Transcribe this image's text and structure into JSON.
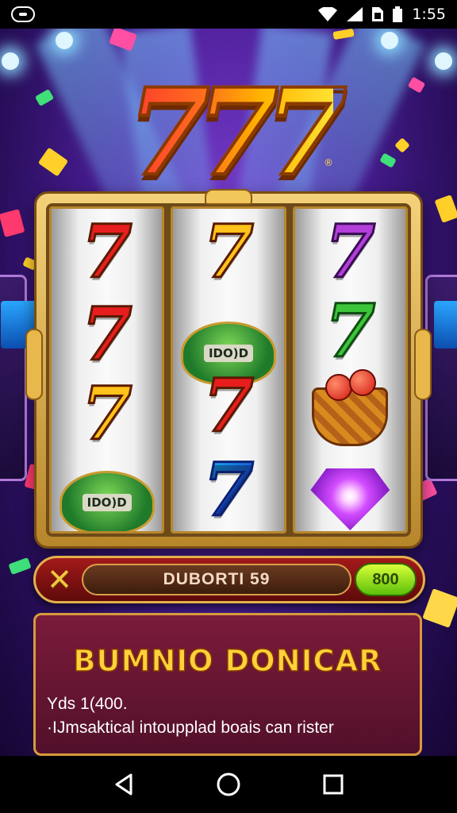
{
  "status_bar": {
    "time": "1:55",
    "icons": [
      "notification-icon",
      "wifi-icon",
      "signal-icon",
      "sim-icon",
      "battery-icon"
    ]
  },
  "game": {
    "logo_text": "777",
    "logo_mark": "®",
    "reels": [
      [
        "red-seven",
        "red-seven",
        "yellow-seven",
        "leaf-bonus"
      ],
      [
        "yellow-seven",
        "leaf-bonus",
        "red-seven",
        "blue-seven"
      ],
      [
        "purple-seven",
        "green-seven",
        "tomato-basket",
        "purple-gem"
      ]
    ],
    "leaf_labels": [
      "IDO)D",
      "IDO)D"
    ],
    "bar": {
      "close_label": "✕",
      "field_text": "DUBORTI 59",
      "bet_label": "800"
    },
    "promo": {
      "title": "BUMNIO DONICAR",
      "line1": "Yds 1(400.",
      "line2": "·IJmsaktical intoupplad boais can rister"
    }
  },
  "colors": {
    "accent_gold": "#e2b04a",
    "bar_red": "#a31a1a",
    "promo_bg": "#7a1b3a",
    "title_yellow": "#ffd23a"
  },
  "navbar": {
    "buttons": [
      "back-icon",
      "home-icon",
      "recents-icon"
    ]
  }
}
